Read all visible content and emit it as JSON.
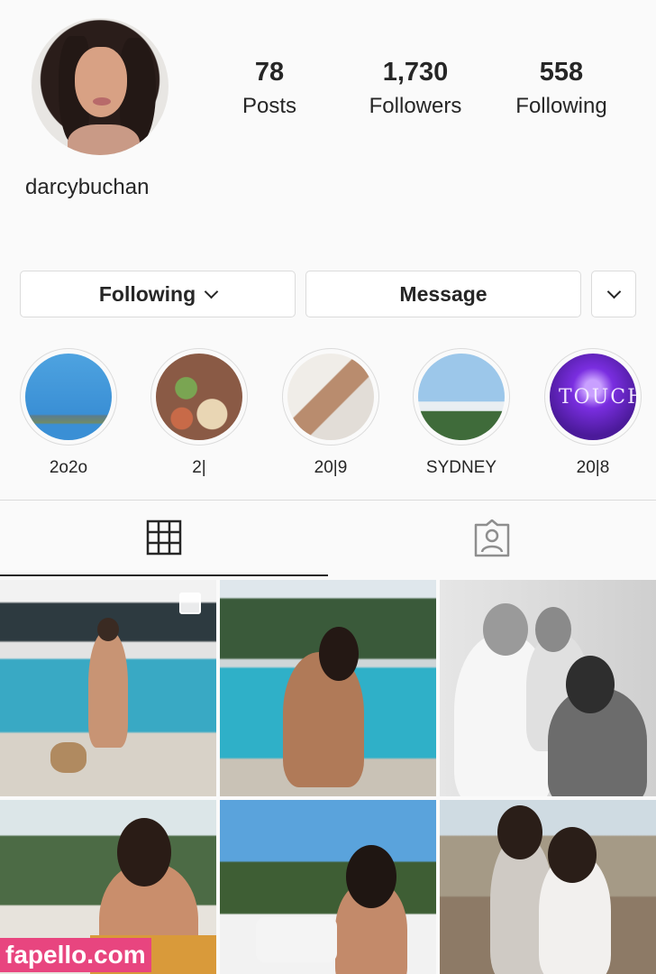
{
  "profile": {
    "username": "darcybuchan",
    "stats": [
      {
        "value": "78",
        "label": "Posts"
      },
      {
        "value": "1,730",
        "label": "Followers"
      },
      {
        "value": "558",
        "label": "Following"
      }
    ]
  },
  "actions": {
    "following_label": "Following",
    "message_label": "Message"
  },
  "highlights": [
    {
      "label": "2o2o"
    },
    {
      "label": "2|"
    },
    {
      "label": "20|9"
    },
    {
      "label": "SYDNEY"
    },
    {
      "label": "20|8"
    }
  ],
  "tabs": [
    {
      "name": "grid",
      "icon": "grid-icon",
      "active": true
    },
    {
      "name": "tagged",
      "icon": "tagged-user-icon",
      "active": false
    }
  ],
  "posts_count_shown": 6,
  "watermark": "fapello.com",
  "colors": {
    "background": "#fafafa",
    "text": "#262626",
    "border": "#dbdbdb",
    "watermark": "#e8457f"
  }
}
